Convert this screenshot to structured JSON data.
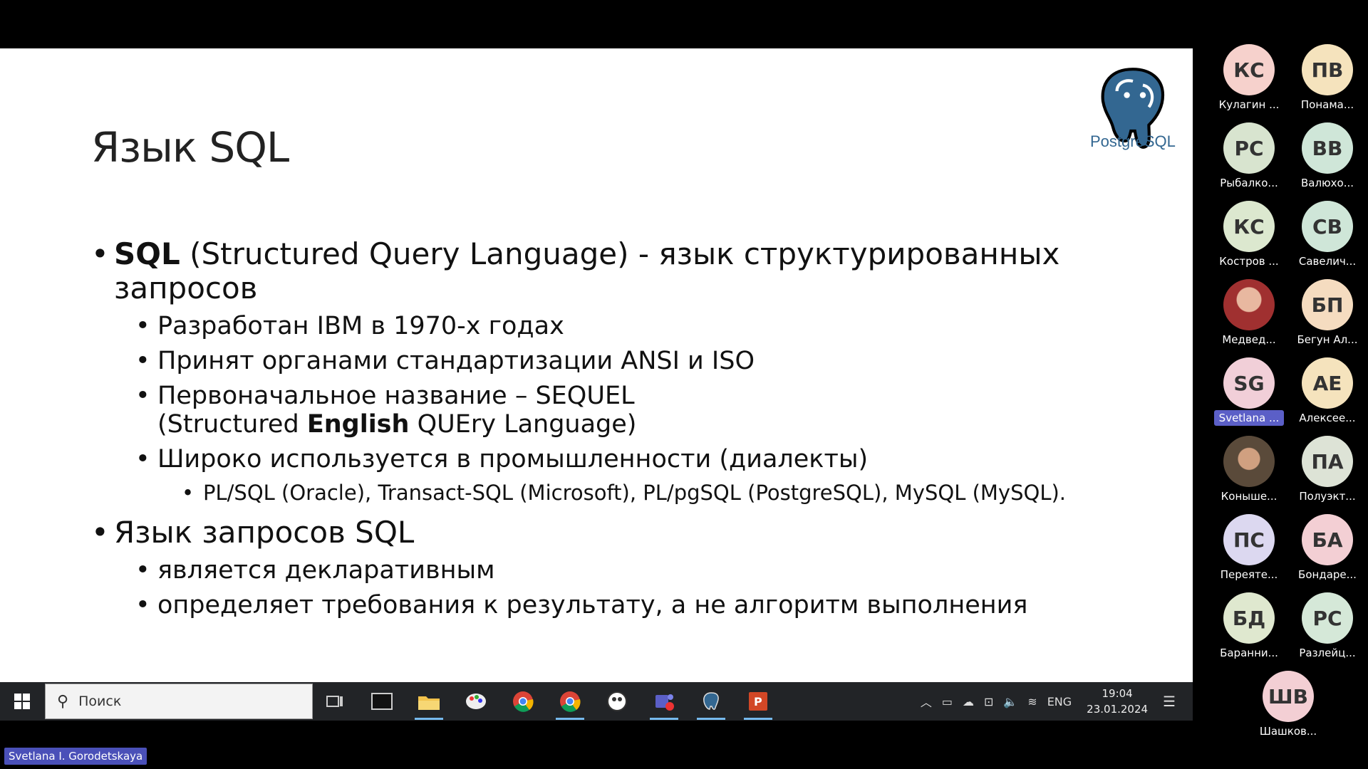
{
  "slide": {
    "title": "Язык SQL",
    "logo_text": "PostgreSQL",
    "bullet": "•",
    "b1": {
      "bold": "SQL",
      "rest_line1": " (Structured Query Language) - язык структурированных",
      "rest_line2": "запросов"
    },
    "b1_sub": [
      "Разработан IBM в 1970-х годах",
      "Принят органами стандартизации ANSI и ISO"
    ],
    "b1_sub3": {
      "line1": "Первоначальное название – SEQUEL",
      "line2_pre": "(Structured ",
      "line2_bold": "English",
      "line2_post": " QUEry Language)"
    },
    "b1_sub4": "Широко используется в промышленности (диалекты)",
    "b1_sub4_sub": "PL/SQL (Oracle), Transact-SQL (Microsoft), PL/pgSQL (PostgreSQL), MySQL (MySQL).",
    "b2": "Язык запросов SQL",
    "b2_sub": [
      "является декларативным",
      "определяет требования к результату, а не алгоритм выполнения"
    ]
  },
  "taskbar": {
    "search_placeholder": "Поиск",
    "lang": "ENG",
    "time": "19:04",
    "date": "23.01.2024"
  },
  "participants": [
    {
      "initials": "КС",
      "name": "Кулагин ...",
      "color": "#f6d1cc"
    },
    {
      "initials": "ПВ",
      "name": "Понама...",
      "color": "#f5e3bd"
    },
    {
      "initials": "РС",
      "name": "Рыбалко...",
      "color": "#d8e4cf"
    },
    {
      "initials": "ВВ",
      "name": "Валюхо...",
      "color": "#cfe6d8"
    },
    {
      "initials": "КС",
      "name": "Костров ...",
      "color": "#dce8cf"
    },
    {
      "initials": "СВ",
      "name": "Савелич...",
      "color": "#cfe6d8"
    },
    {
      "initials": "",
      "name": "Медвед...",
      "color": "#a04040"
    },
    {
      "initials": "БП",
      "name": "Бегун Ал...",
      "color": "#f5dcc0"
    },
    {
      "initials": "SG",
      "name": "Svetlana ...",
      "color": "#f1cfd8"
    },
    {
      "initials": "АЕ",
      "name": "Алексее...",
      "color": "#f5e3bd"
    },
    {
      "initials": "",
      "name": "Коныше...",
      "color": "#6b5a48"
    },
    {
      "initials": "ПА",
      "name": "Полуэкт...",
      "color": "#dde3d6"
    },
    {
      "initials": "ПС",
      "name": "Переяте...",
      "color": "#dcd8f0"
    },
    {
      "initials": "БА",
      "name": "Бондаре...",
      "color": "#f3cfd4"
    },
    {
      "initials": "БД",
      "name": "Баранни...",
      "color": "#dfe8cf"
    },
    {
      "initials": "РС",
      "name": "Разлейц...",
      "color": "#d5e8d8"
    },
    {
      "initials": "ШВ",
      "name": "Шашков...",
      "color": "#f3cfd4"
    }
  ],
  "presenter_label": "Svetlana I. Gorodetskaya"
}
